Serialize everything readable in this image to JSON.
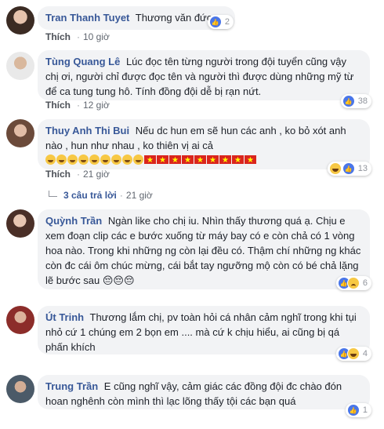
{
  "common": {
    "like_label": "Thích",
    "reply_dot": "·"
  },
  "comments": [
    {
      "name": "Tran Thanh Tuyet",
      "text": "Thương văn đức",
      "time": "10 giờ",
      "reaction_count": "2",
      "reactions": [
        "like"
      ]
    },
    {
      "name": "Tùng Quang Lê",
      "text": "Lúc đọc tên từng người trong đội tuyển cũng vậy chị ơi, người chỉ được đọc tên và người thì được dùng những mỹ từ để ca tung tung hô. Tính đồng đội dễ bị rạn nứt.",
      "time": "12 giờ",
      "reaction_count": "38",
      "reactions": [
        "like"
      ]
    },
    {
      "name": "Thuy Anh Thi Bui",
      "text": "Nếu dc hun em sẽ hun các anh , ko bỏ xót anh nào , hun như nhau , ko thiên vị ai cả",
      "time": "21 giờ",
      "reaction_count": "13",
      "reactions": [
        "haha",
        "like"
      ],
      "replies_label": "3 câu trả lời",
      "replies_time": "21 giờ"
    },
    {
      "name": "Quỳnh Trần",
      "text": "Ngàn like cho chị iu. Nhìn thấy thương quá ạ. Chịu e xem đoạn clip các e bước xuống từ máy bay có e còn chả có 1 vòng hoa nào. Trong khi những ng còn lại đều có. Thậm chí những ng khác còn đc cái ôm chúc mừng, cái bắt tay ngưỡng mộ còn có bé chả lặng lẽ bước sau 😔😔😔",
      "time": "",
      "reaction_count": "6",
      "reactions": [
        "like",
        "sad"
      ]
    },
    {
      "name": "Út Trinh",
      "text": "Thương lắm chị, pv toàn hỏi cá nhân cảm nghĩ trong khi tụi nhỏ cứ 1 chúng em 2 bọn em .... mà cứ k chịu hiểu, ai cũng bị qá phấn khích",
      "time": "",
      "reaction_count": "4",
      "reactions": [
        "like",
        "haha"
      ]
    },
    {
      "name": "Trung Trần",
      "text": "E cũng nghĩ vậy, cảm giác các đồng đội đc chào đón hoan nghênh còn mình thì lạc lõng thấy tội các bạn quá",
      "time": "",
      "reaction_count": "1",
      "reactions": [
        "like"
      ]
    }
  ]
}
